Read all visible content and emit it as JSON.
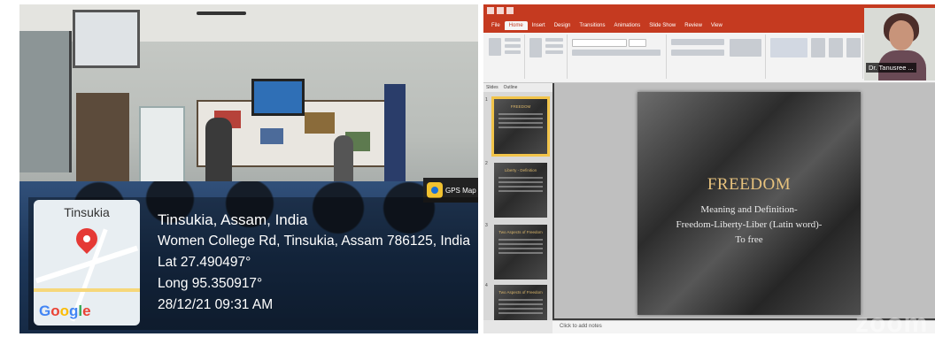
{
  "photo": {
    "gps_app": "GPS Map",
    "map_city": "Tinsukia",
    "map_logo": "Google",
    "location_title": "Tinsukia, Assam, India",
    "address": "Women College Rd, Tinsukia, Assam 786125, India",
    "lat": "Lat 27.490497°",
    "long": "Long 95.350917°",
    "timestamp": "28/12/21 09:31 AM",
    "colors": {
      "pin": "#e53935",
      "overlay_text": "#ffffff"
    }
  },
  "zoom": {
    "participant_name": "Dr. Tanusree ...",
    "watermark": "zoom",
    "powerpoint": {
      "ribbon_tabs": [
        "File",
        "Home",
        "Insert",
        "Design",
        "Transitions",
        "Animations",
        "Slide Show",
        "Review",
        "View"
      ],
      "active_tab": "Home",
      "pane_tabs": [
        "Slides",
        "Outline"
      ],
      "slide_numbers": [
        "1",
        "2",
        "3",
        "4"
      ],
      "thumbnails": [
        "FREEDOM",
        "Liberty - Definition",
        "Two Aspects of Freedom",
        "Two Aspects of Freedom"
      ],
      "slide": {
        "title": "FREEDOM",
        "line1": "Meaning and Definition-",
        "line2": "Freedom-Liberty-Liber (Latin word)-",
        "line3": "To free"
      },
      "notes_placeholder": "Click to add notes",
      "colors": {
        "ribbon": "#c53a20",
        "title": "#e7c27d",
        "selection": "#f2c44a"
      }
    }
  }
}
